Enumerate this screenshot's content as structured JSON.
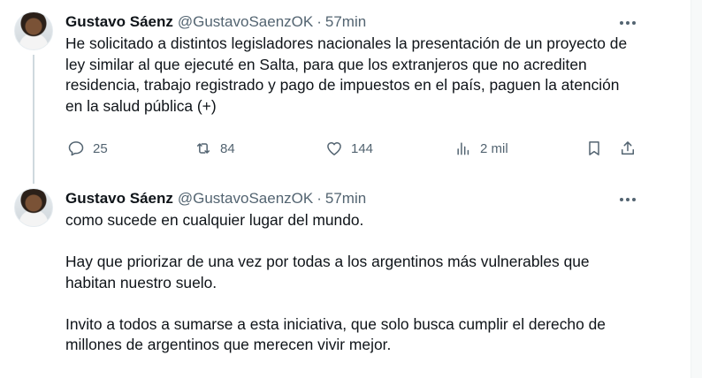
{
  "tweets": [
    {
      "author_name": "Gustavo Sáenz",
      "handle": "@GustavoSaenzOK",
      "separator": "·",
      "time": "57min",
      "paragraphs": [
        "He solicitado a distintos legisladores nacionales la presentación de un proyecto de ley similar al que ejecuté en Salta, para que los extranjeros que no acrediten residencia, trabajo registrado y pago de impuestos en el país, paguen la atención en la salud pública (+)"
      ],
      "actions": {
        "replies": "25",
        "retweets": "84",
        "likes": "144",
        "views": "2 mil"
      }
    },
    {
      "author_name": "Gustavo Sáenz",
      "handle": "@GustavoSaenzOK",
      "separator": "·",
      "time": "57min",
      "paragraphs": [
        "como sucede en cualquier lugar del mundo.",
        "Hay que priorizar de una vez por todas a los argentinos más vulnerables que habitan nuestro suelo.",
        "Invito a todos a sumarse a esta iniciativa, que solo busca cumplir el derecho de millones de argentinos que merecen vivir mejor."
      ]
    }
  ],
  "icons": {
    "reply": "speech-bubble-icon",
    "retweet": "retweet-arrows-icon",
    "like": "heart-icon",
    "views": "bar-chart-icon",
    "bookmark": "bookmark-icon",
    "share": "share-upload-icon",
    "more": "ellipsis-icon"
  },
  "colors": {
    "text": "#0f1419",
    "secondary": "#536471",
    "thread_line": "#cfd9de",
    "background": "#ffffff"
  }
}
